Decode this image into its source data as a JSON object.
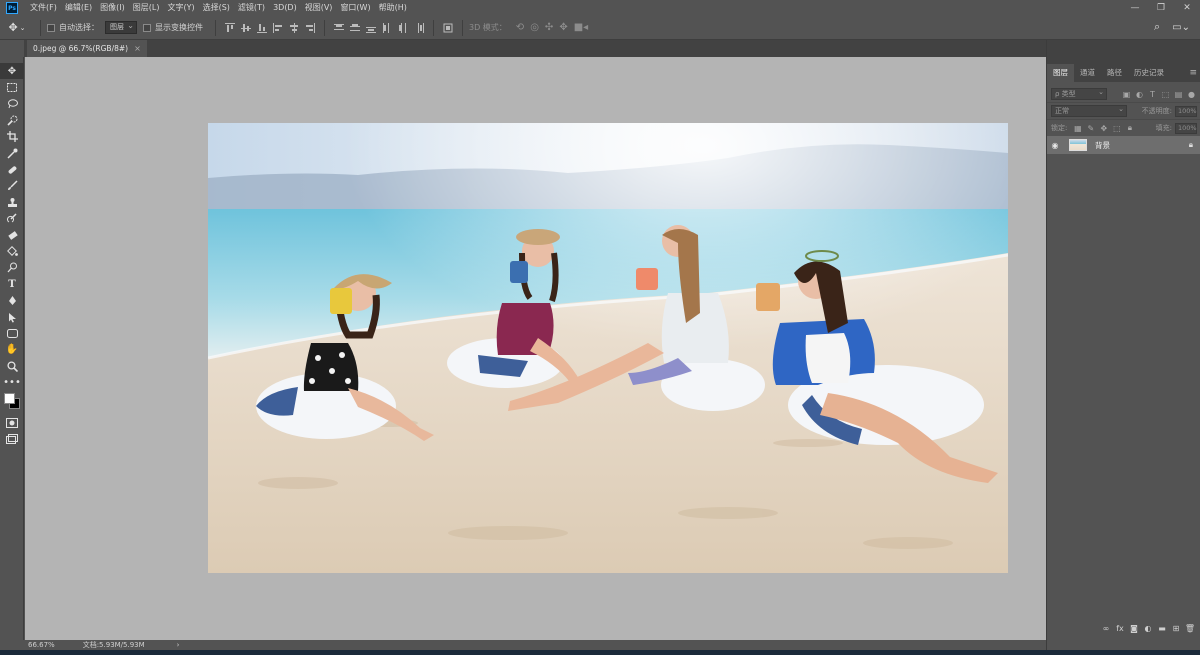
{
  "app": {
    "logo_text": "Ps",
    "menu": [
      "文件(F)",
      "编辑(E)",
      "图像(I)",
      "图层(L)",
      "文字(Y)",
      "选择(S)",
      "滤镜(T)",
      "3D(D)",
      "视图(V)",
      "窗口(W)",
      "帮助(H)"
    ],
    "window_controls": {
      "minimize": "—",
      "restore": "❐",
      "close": "✕"
    }
  },
  "options_bar": {
    "auto_select_label": "自动选择：",
    "auto_select_value": "图层",
    "show_transform_label": "显示变换控件",
    "mode_3d_label": "3D 模式："
  },
  "document": {
    "tab_title": "0.jpeg @ 66.7%(RGB/8#)",
    "close_symbol": "×"
  },
  "status_bar": {
    "zoom": "66.67%",
    "doc_info": "文档:5.93M/5.93M",
    "arrow": "›"
  },
  "layers_panel": {
    "tabs": [
      "图层",
      "通道",
      "路径",
      "历史记录"
    ],
    "active_tab": 0,
    "filter_kind": "ρ 类型",
    "blend_mode": "正常",
    "opacity_label": "不透明度:",
    "opacity_value": "100%",
    "lock_label": "锁定:",
    "fill_label": "填充:",
    "fill_value": "100%",
    "layers": [
      {
        "name": "背景",
        "visible": true,
        "locked": true
      }
    ]
  },
  "colors": {
    "ui_bg": "#535353",
    "canvas_bg": "#b4b4b4",
    "accent": "#31a8ff"
  }
}
